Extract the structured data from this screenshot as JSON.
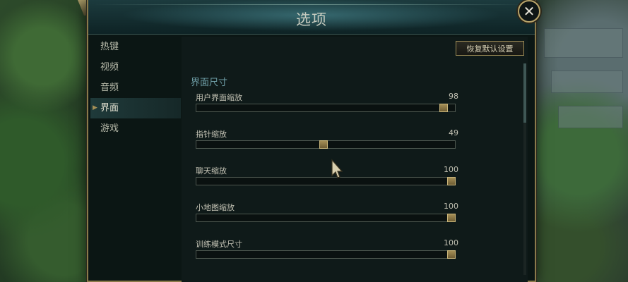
{
  "window": {
    "title": "选项",
    "close_label": "✕"
  },
  "sidebar": {
    "items": [
      {
        "label": "热键",
        "active": false
      },
      {
        "label": "视频",
        "active": false
      },
      {
        "label": "音频",
        "active": false
      },
      {
        "label": "界面",
        "active": true
      },
      {
        "label": "游戏",
        "active": false
      }
    ]
  },
  "content": {
    "reset_label": "恢复默认设置",
    "section_title": "界面尺寸",
    "settings": [
      {
        "label": "用户界面缩放",
        "value": "98",
        "level": 0.97
      },
      {
        "label": "指针缩放",
        "value": "49",
        "level": 0.49
      },
      {
        "label": "聊天缩放",
        "value": "100",
        "level": 1.0
      },
      {
        "label": "小地图缩放",
        "value": "100",
        "level": 1.0
      },
      {
        "label": "训练模式尺寸",
        "value": "100",
        "level": 1.0
      }
    ]
  },
  "colors": {
    "accent": "#a58f56",
    "section": "#6e9ea6",
    "panel": "#0f1a19"
  }
}
